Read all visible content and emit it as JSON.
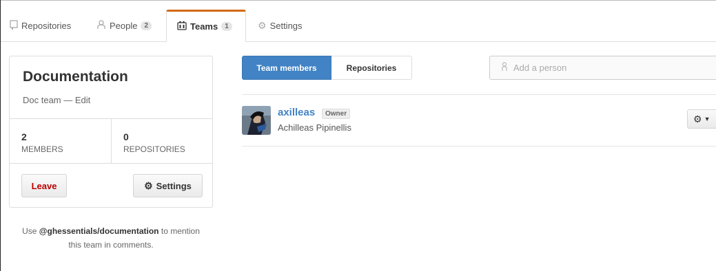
{
  "tabs": [
    {
      "label": "Repositories",
      "icon": "repo-icon",
      "count": null
    },
    {
      "label": "People",
      "icon": "people-icon",
      "count": "2"
    },
    {
      "label": "Teams",
      "icon": "team-icon",
      "count": "1"
    },
    {
      "label": "Settings",
      "icon": "gear-icon",
      "count": null
    }
  ],
  "team": {
    "name": "Documentation",
    "description": "Doc team",
    "separator": "—",
    "edit_label": "Edit",
    "members_count": "2",
    "members_label": "MEMBERS",
    "repos_count": "0",
    "repos_label": "REPOSITORIES",
    "leave_label": "Leave",
    "settings_label": "Settings"
  },
  "mention": {
    "prefix": "Use",
    "handle": "@ghessentials/documentation",
    "suffix_line1": "to mention",
    "line2": "this team in comments."
  },
  "view_toggle": {
    "members_label": "Team members",
    "repos_label": "Repositories"
  },
  "search": {
    "placeholder": "Add a person"
  },
  "members": [
    {
      "login": "axilleas",
      "badge": "Owner",
      "full_name": "Achilleas Pipinellis"
    }
  ],
  "colors": {
    "accent": "#4183c4",
    "tab_active": "#d26911",
    "danger": "#bb0000"
  }
}
